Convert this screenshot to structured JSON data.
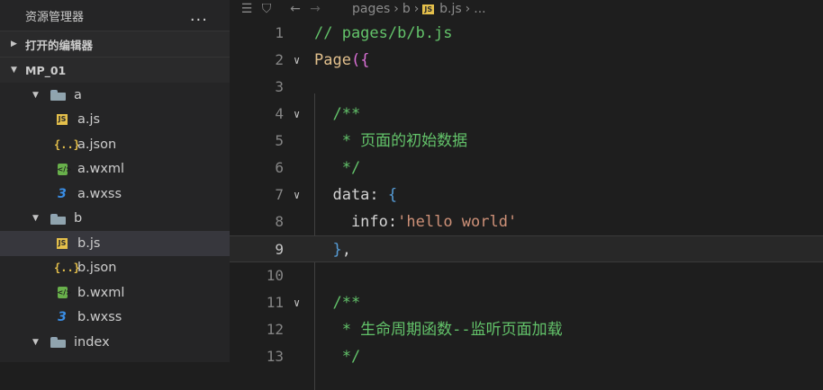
{
  "sidebar": {
    "title": "资源管理器",
    "more_label": "...",
    "open_editors_label": "打开的编辑器",
    "project_label": "MP_01",
    "tree": [
      {
        "label": "a",
        "type": "folder",
        "indent": 1,
        "expanded": true
      },
      {
        "label": "a.js",
        "type": "js",
        "indent": 2
      },
      {
        "label": "a.json",
        "type": "json",
        "indent": 2
      },
      {
        "label": "a.wxml",
        "type": "wxml",
        "indent": 2
      },
      {
        "label": "a.wxss",
        "type": "wxss",
        "indent": 2
      },
      {
        "label": "b",
        "type": "folder",
        "indent": 1,
        "expanded": true
      },
      {
        "label": "b.js",
        "type": "js",
        "indent": 2,
        "selected": true
      },
      {
        "label": "b.json",
        "type": "json",
        "indent": 2
      },
      {
        "label": "b.wxml",
        "type": "wxml",
        "indent": 2
      },
      {
        "label": "b.wxss",
        "type": "wxss",
        "indent": 2
      },
      {
        "label": "index",
        "type": "folder",
        "indent": 1,
        "expanded": true
      }
    ]
  },
  "breadcrumb": {
    "crumbs": [
      "pages",
      "b",
      "b.js",
      "..."
    ]
  },
  "editor": {
    "current_line": 9,
    "lines": [
      {
        "num": "1",
        "fold": false,
        "tokens": [
          {
            "t": "// pages/b/b.js",
            "c": "c-green"
          }
        ]
      },
      {
        "num": "2",
        "fold": true,
        "tokens": [
          {
            "t": "Page",
            "c": "c-fn"
          },
          {
            "t": "(",
            "c": "c-pink"
          },
          {
            "t": "{",
            "c": "c-pink"
          }
        ]
      },
      {
        "num": "3",
        "fold": false,
        "tokens": []
      },
      {
        "num": "4",
        "fold": true,
        "tokens": [
          {
            "t": "  /**",
            "c": "c-green"
          }
        ]
      },
      {
        "num": "5",
        "fold": false,
        "tokens": [
          {
            "t": "   * 页面的初始数据",
            "c": "c-green"
          }
        ]
      },
      {
        "num": "6",
        "fold": false,
        "tokens": [
          {
            "t": "   */",
            "c": "c-green"
          }
        ]
      },
      {
        "num": "7",
        "fold": true,
        "tokens": [
          {
            "t": "  data",
            "c": "c-key"
          },
          {
            "t": ": ",
            "c": "c-punct"
          },
          {
            "t": "{",
            "c": "c-brace"
          }
        ]
      },
      {
        "num": "8",
        "fold": false,
        "tokens": [
          {
            "t": "    info",
            "c": "c-key"
          },
          {
            "t": ":",
            "c": "c-punct"
          },
          {
            "t": "'hello world'",
            "c": "c-str"
          }
        ]
      },
      {
        "num": "9",
        "fold": false,
        "tokens": [
          {
            "t": "  }",
            "c": "c-brace"
          },
          {
            "t": ",",
            "c": "c-punct"
          }
        ]
      },
      {
        "num": "10",
        "fold": false,
        "tokens": []
      },
      {
        "num": "11",
        "fold": true,
        "tokens": [
          {
            "t": "  /**",
            "c": "c-green"
          }
        ]
      },
      {
        "num": "12",
        "fold": false,
        "tokens": [
          {
            "t": "   * 生命周期函数--监听页面加载",
            "c": "c-green"
          }
        ]
      },
      {
        "num": "13",
        "fold": false,
        "tokens": [
          {
            "t": "   */",
            "c": "c-green"
          }
        ]
      }
    ]
  }
}
